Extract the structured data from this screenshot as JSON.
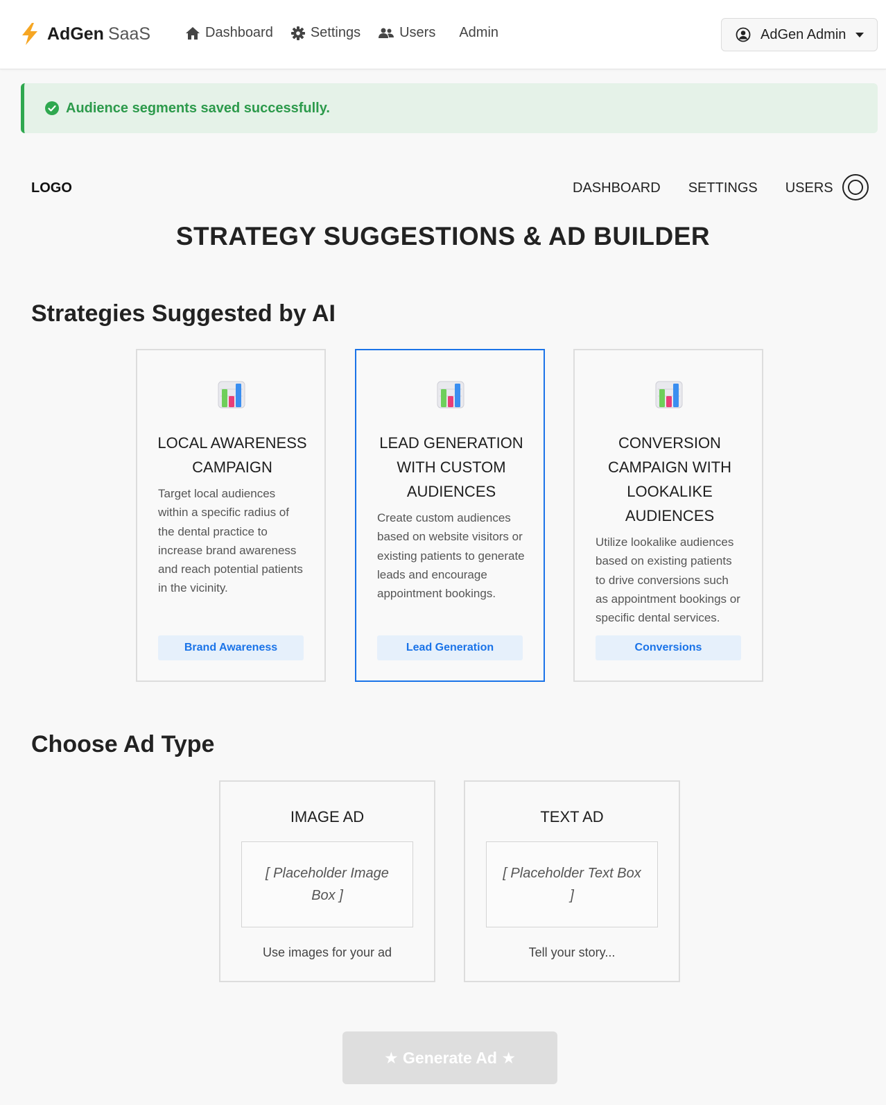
{
  "app": {
    "brand_name": "AdGen",
    "brand_suffix": "SaaS",
    "nav": [
      {
        "label": "Dashboard",
        "icon": "home-icon"
      },
      {
        "label": "Settings",
        "icon": "gear-icon"
      },
      {
        "label": "Users",
        "icon": "users-icon"
      },
      {
        "label": "Admin"
      }
    ],
    "user_menu_label": "AdGen Admin"
  },
  "alert": {
    "message": "Audience segments saved successfully.",
    "color": "#2c9a4b"
  },
  "inner_nav": {
    "logo": "LOGO",
    "links": [
      "DASHBOARD",
      "SETTINGS",
      "USERS"
    ]
  },
  "page_title": "STRATEGY SUGGESTIONS & AD BUILDER",
  "strategies": {
    "heading": "Strategies Suggested by AI",
    "cards": [
      {
        "title": "LOCAL AWARENESS CAMPAIGN",
        "description": "Target local audiences within a specific radius of the dental practice to increase brand awareness and reach potential patients in the vicinity.",
        "tag": "Brand Awareness",
        "selected": false
      },
      {
        "title": "LEAD GENERATION WITH CUSTOM AUDIENCES",
        "description": "Create custom audiences based on website visitors or existing patients to generate leads and encourage appointment bookings.",
        "tag": "Lead Generation",
        "selected": true
      },
      {
        "title": "CONVERSION CAMPAIGN WITH LOOKALIKE AUDIENCES",
        "description": "Utilize lookalike audiences based on existing patients to drive conversions such as appointment bookings or specific dental services.",
        "tag": "Conversions",
        "selected": false
      }
    ]
  },
  "ad_types": {
    "heading": "Choose Ad Type",
    "cards": [
      {
        "title": "IMAGE AD",
        "placeholder": "[ Placeholder Image Box ]",
        "caption": "Use images for your ad"
      },
      {
        "title": "TEXT AD",
        "placeholder": "[ Placeholder Text Box ]",
        "caption": "Tell your story..."
      }
    ]
  },
  "generate_button": "★ Generate Ad ★",
  "colors": {
    "accent": "#1a73e8",
    "success": "#2fa84f",
    "tag_bg": "#e6f0fb",
    "disabled_button": "#dedede"
  }
}
